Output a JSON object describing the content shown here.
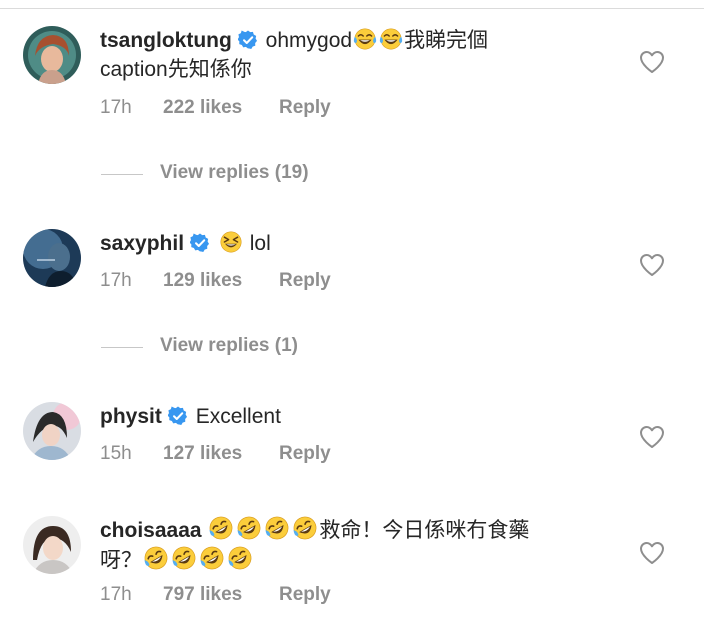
{
  "comments": [
    {
      "username": "tsangloktung",
      "text_line1": "ohmygod",
      "text_line1_suffix": "我睇完個",
      "text_line2": "caption先知係你",
      "emojis": [
        "face-with-tears-of-joy",
        "face-with-tears-of-joy"
      ],
      "time": "17h",
      "likes": "222 likes",
      "reply": "Reply",
      "view_replies": "View replies (19)"
    },
    {
      "username": "saxyphil",
      "text_line1": "lol",
      "emojis": [
        "grinning-squinting-face"
      ],
      "time": "17h",
      "likes": "129 likes",
      "reply": "Reply",
      "view_replies": "View replies (1)"
    },
    {
      "username": "physit",
      "text_line1": "Excellent",
      "time": "15h",
      "likes": "127 likes",
      "reply": "Reply"
    },
    {
      "username": "choisaaaa",
      "text_line1": "救命！今日係咪冇食藥",
      "text_line2": "呀？",
      "emojis": [
        "rolling-on-floor-laughing",
        "rolling-on-floor-laughing",
        "rolling-on-floor-laughing",
        "rolling-on-floor-laughing",
        "rolling-on-floor-laughing",
        "rolling-on-floor-laughing",
        "rolling-on-floor-laughing",
        "rolling-on-floor-laughing"
      ],
      "time": "17h",
      "likes": "797 likes",
      "reply": "Reply"
    }
  ],
  "colors": {
    "text": "#262626",
    "meta": "#8e8e8e",
    "verified": "#3897f0",
    "emoji": "#fbcd3b"
  }
}
